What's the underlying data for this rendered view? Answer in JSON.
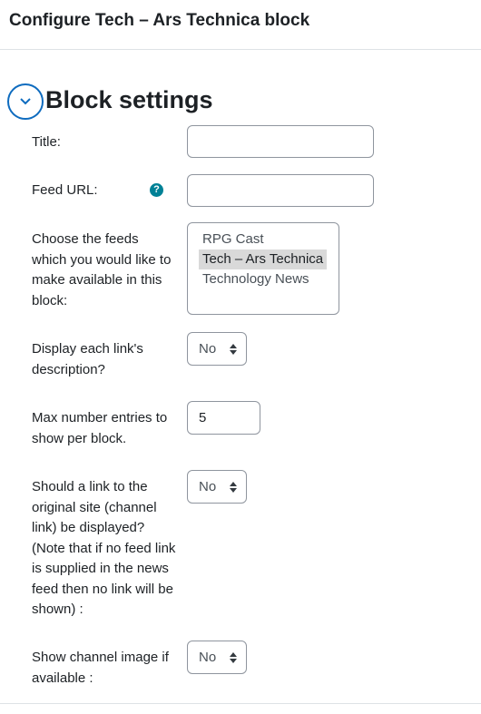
{
  "header": {
    "title": "Configure Tech – Ars Technica block"
  },
  "section": {
    "title": "Block settings"
  },
  "fields": {
    "title": {
      "label": "Title:",
      "value": ""
    },
    "feed_url": {
      "label": "Feed URL:",
      "value": "",
      "help": "?"
    },
    "choose_feeds": {
      "label": "Choose the feeds which you would like to make available in this block:",
      "options": [
        "RPG Cast",
        "Tech – Ars Technica",
        "Technology News"
      ],
      "selected": "Tech – Ars Technica"
    },
    "display_description": {
      "label": "Display each link's description?",
      "value": "No"
    },
    "max_entries": {
      "label": "Max number entries to show per block.",
      "value": "5"
    },
    "channel_link": {
      "label": "Should a link to the original site (channel link) be displayed? (Note that if no feed link is supplied in the news feed then no link will be shown) :",
      "value": "No"
    },
    "channel_image": {
      "label": "Show channel image if available :",
      "value": "No"
    }
  },
  "colors": {
    "accent": "#0f6cbf",
    "help": "#008196",
    "border": "#8f959e",
    "selected_bg": "#d9d9d9"
  },
  "icons": {
    "collapse": "chevron-down-icon",
    "help": "question-circle-icon",
    "select": "sort-arrows-icon"
  }
}
